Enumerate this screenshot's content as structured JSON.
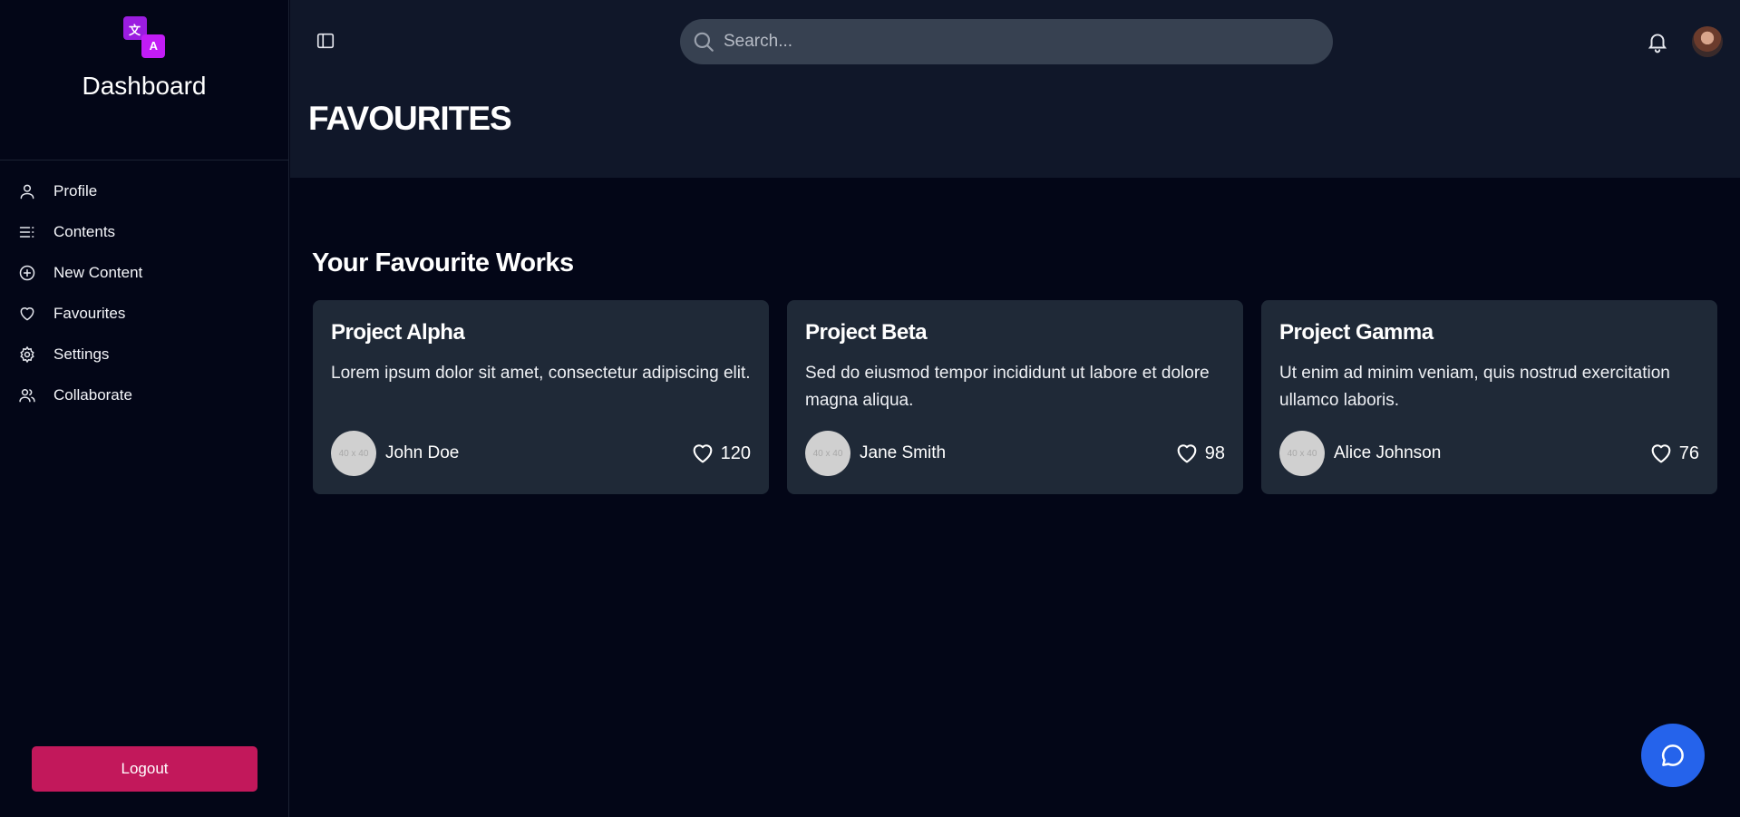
{
  "app": {
    "title": "Dashboard",
    "logo_glyphs": [
      "文",
      "A"
    ]
  },
  "sidebar": {
    "items": [
      {
        "label": "Profile",
        "icon": "user-icon"
      },
      {
        "label": "Contents",
        "icon": "list-icon"
      },
      {
        "label": "New Content",
        "icon": "plus-circle-icon"
      },
      {
        "label": "Favourites",
        "icon": "heart-icon"
      },
      {
        "label": "Settings",
        "icon": "gear-icon"
      },
      {
        "label": "Collaborate",
        "icon": "users-icon"
      }
    ],
    "logout_label": "Logout"
  },
  "header": {
    "search_placeholder": "Search...",
    "page_title": "FAVOURITES"
  },
  "main": {
    "section_title": "Your Favourite Works",
    "cards": [
      {
        "title": "Project Alpha",
        "description": "Lorem ipsum dolor sit amet, consectetur adipiscing elit.",
        "avatar_placeholder": "40 x 40",
        "author": "John Doe",
        "likes": "120"
      },
      {
        "title": "Project Beta",
        "description": "Sed do eiusmod tempor incididunt ut labore et dolore magna aliqua.",
        "avatar_placeholder": "40 x 40",
        "author": "Jane Smith",
        "likes": "98"
      },
      {
        "title": "Project Gamma",
        "description": "Ut enim ad minim veniam, quis nostrud exercitation ullamco laboris.",
        "avatar_placeholder": "40 x 40",
        "author": "Alice Johnson",
        "likes": "76"
      }
    ]
  },
  "colors": {
    "background": "#030617",
    "header": "#101729",
    "card": "#1f2937",
    "logout": "#c2185b",
    "chat_button": "#2563eb",
    "logo_accent": "#c21cf5"
  }
}
